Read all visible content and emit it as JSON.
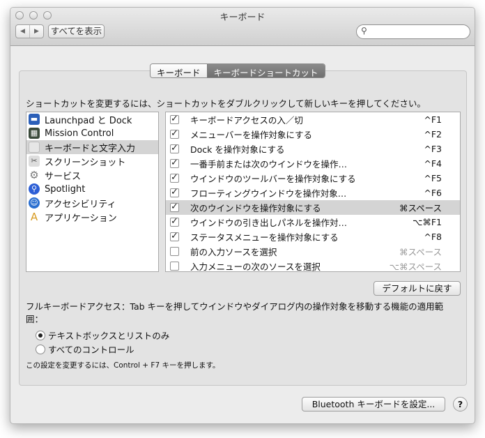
{
  "window": {
    "title": "キーボード"
  },
  "toolbar": {
    "show_all": "すべてを表示",
    "back_icon": "◀",
    "forward_icon": "▶",
    "search_placeholder": ""
  },
  "tabs": [
    {
      "label": "キーボード",
      "selected": false
    },
    {
      "label": "キーボードショートカット",
      "selected": true
    }
  ],
  "instructions": "ショートカットを変更するには、ショートカットをダブルクリックして新しいキーを押してください。",
  "categories": [
    {
      "label": "Launchpad と Dock",
      "icon": "launchpad-dock-icon"
    },
    {
      "label": "Mission Control",
      "icon": "mission-control-icon"
    },
    {
      "label": "キーボードと文字入力",
      "icon": "keyboard-icon",
      "selected": true
    },
    {
      "label": "スクリーンショット",
      "icon": "screenshot-icon"
    },
    {
      "label": "サービス",
      "icon": "gear-icon"
    },
    {
      "label": "Spotlight",
      "icon": "spotlight-icon"
    },
    {
      "label": "アクセシビリティ",
      "icon": "accessibility-icon"
    },
    {
      "label": "アプリケーション",
      "icon": "applications-icon"
    }
  ],
  "shortcuts": [
    {
      "checked": true,
      "label": "キーボードアクセスの入／切",
      "key": "^F1"
    },
    {
      "checked": true,
      "label": "メニューバーを操作対象にする",
      "key": "^F2"
    },
    {
      "checked": true,
      "label": "Dock を操作対象にする",
      "key": "^F3"
    },
    {
      "checked": true,
      "label": "一番手前または次のウインドウを操作…",
      "key": "^F4"
    },
    {
      "checked": true,
      "label": "ウインドウのツールバーを操作対象にする",
      "key": "^F5"
    },
    {
      "checked": true,
      "label": "フローティングウインドウを操作対象…",
      "key": "^F6"
    },
    {
      "checked": true,
      "label": "次のウインドウを操作対象にする",
      "key": "⌘スペース",
      "selected": true
    },
    {
      "checked": true,
      "label": "ウインドウの引き出しパネルを操作対…",
      "key": "⌥⌘F1"
    },
    {
      "checked": true,
      "label": "ステータスメニューを操作対象にする",
      "key": "^F8"
    },
    {
      "checked": false,
      "label": "前の入力ソースを選択",
      "key": "⌘スペース"
    },
    {
      "checked": false,
      "label": "入力メニューの次のソースを選択",
      "key": "⌥⌘スペース"
    }
  ],
  "defaults_button": "デフォルトに戻す",
  "full_access_text": "フルキーボードアクセス：Tab キーを押してウインドウやダイアログ内の操作対象を移動する機能の適用範囲：",
  "radios": [
    {
      "label": "テキストボックスとリストのみ",
      "selected": true
    },
    {
      "label": "すべてのコントロール",
      "selected": false
    }
  ],
  "note": "この設定を変更するには、Control + F7 キーを押します。",
  "bluetooth_button": "Bluetooth キーボードを設定...",
  "help_button": "?"
}
